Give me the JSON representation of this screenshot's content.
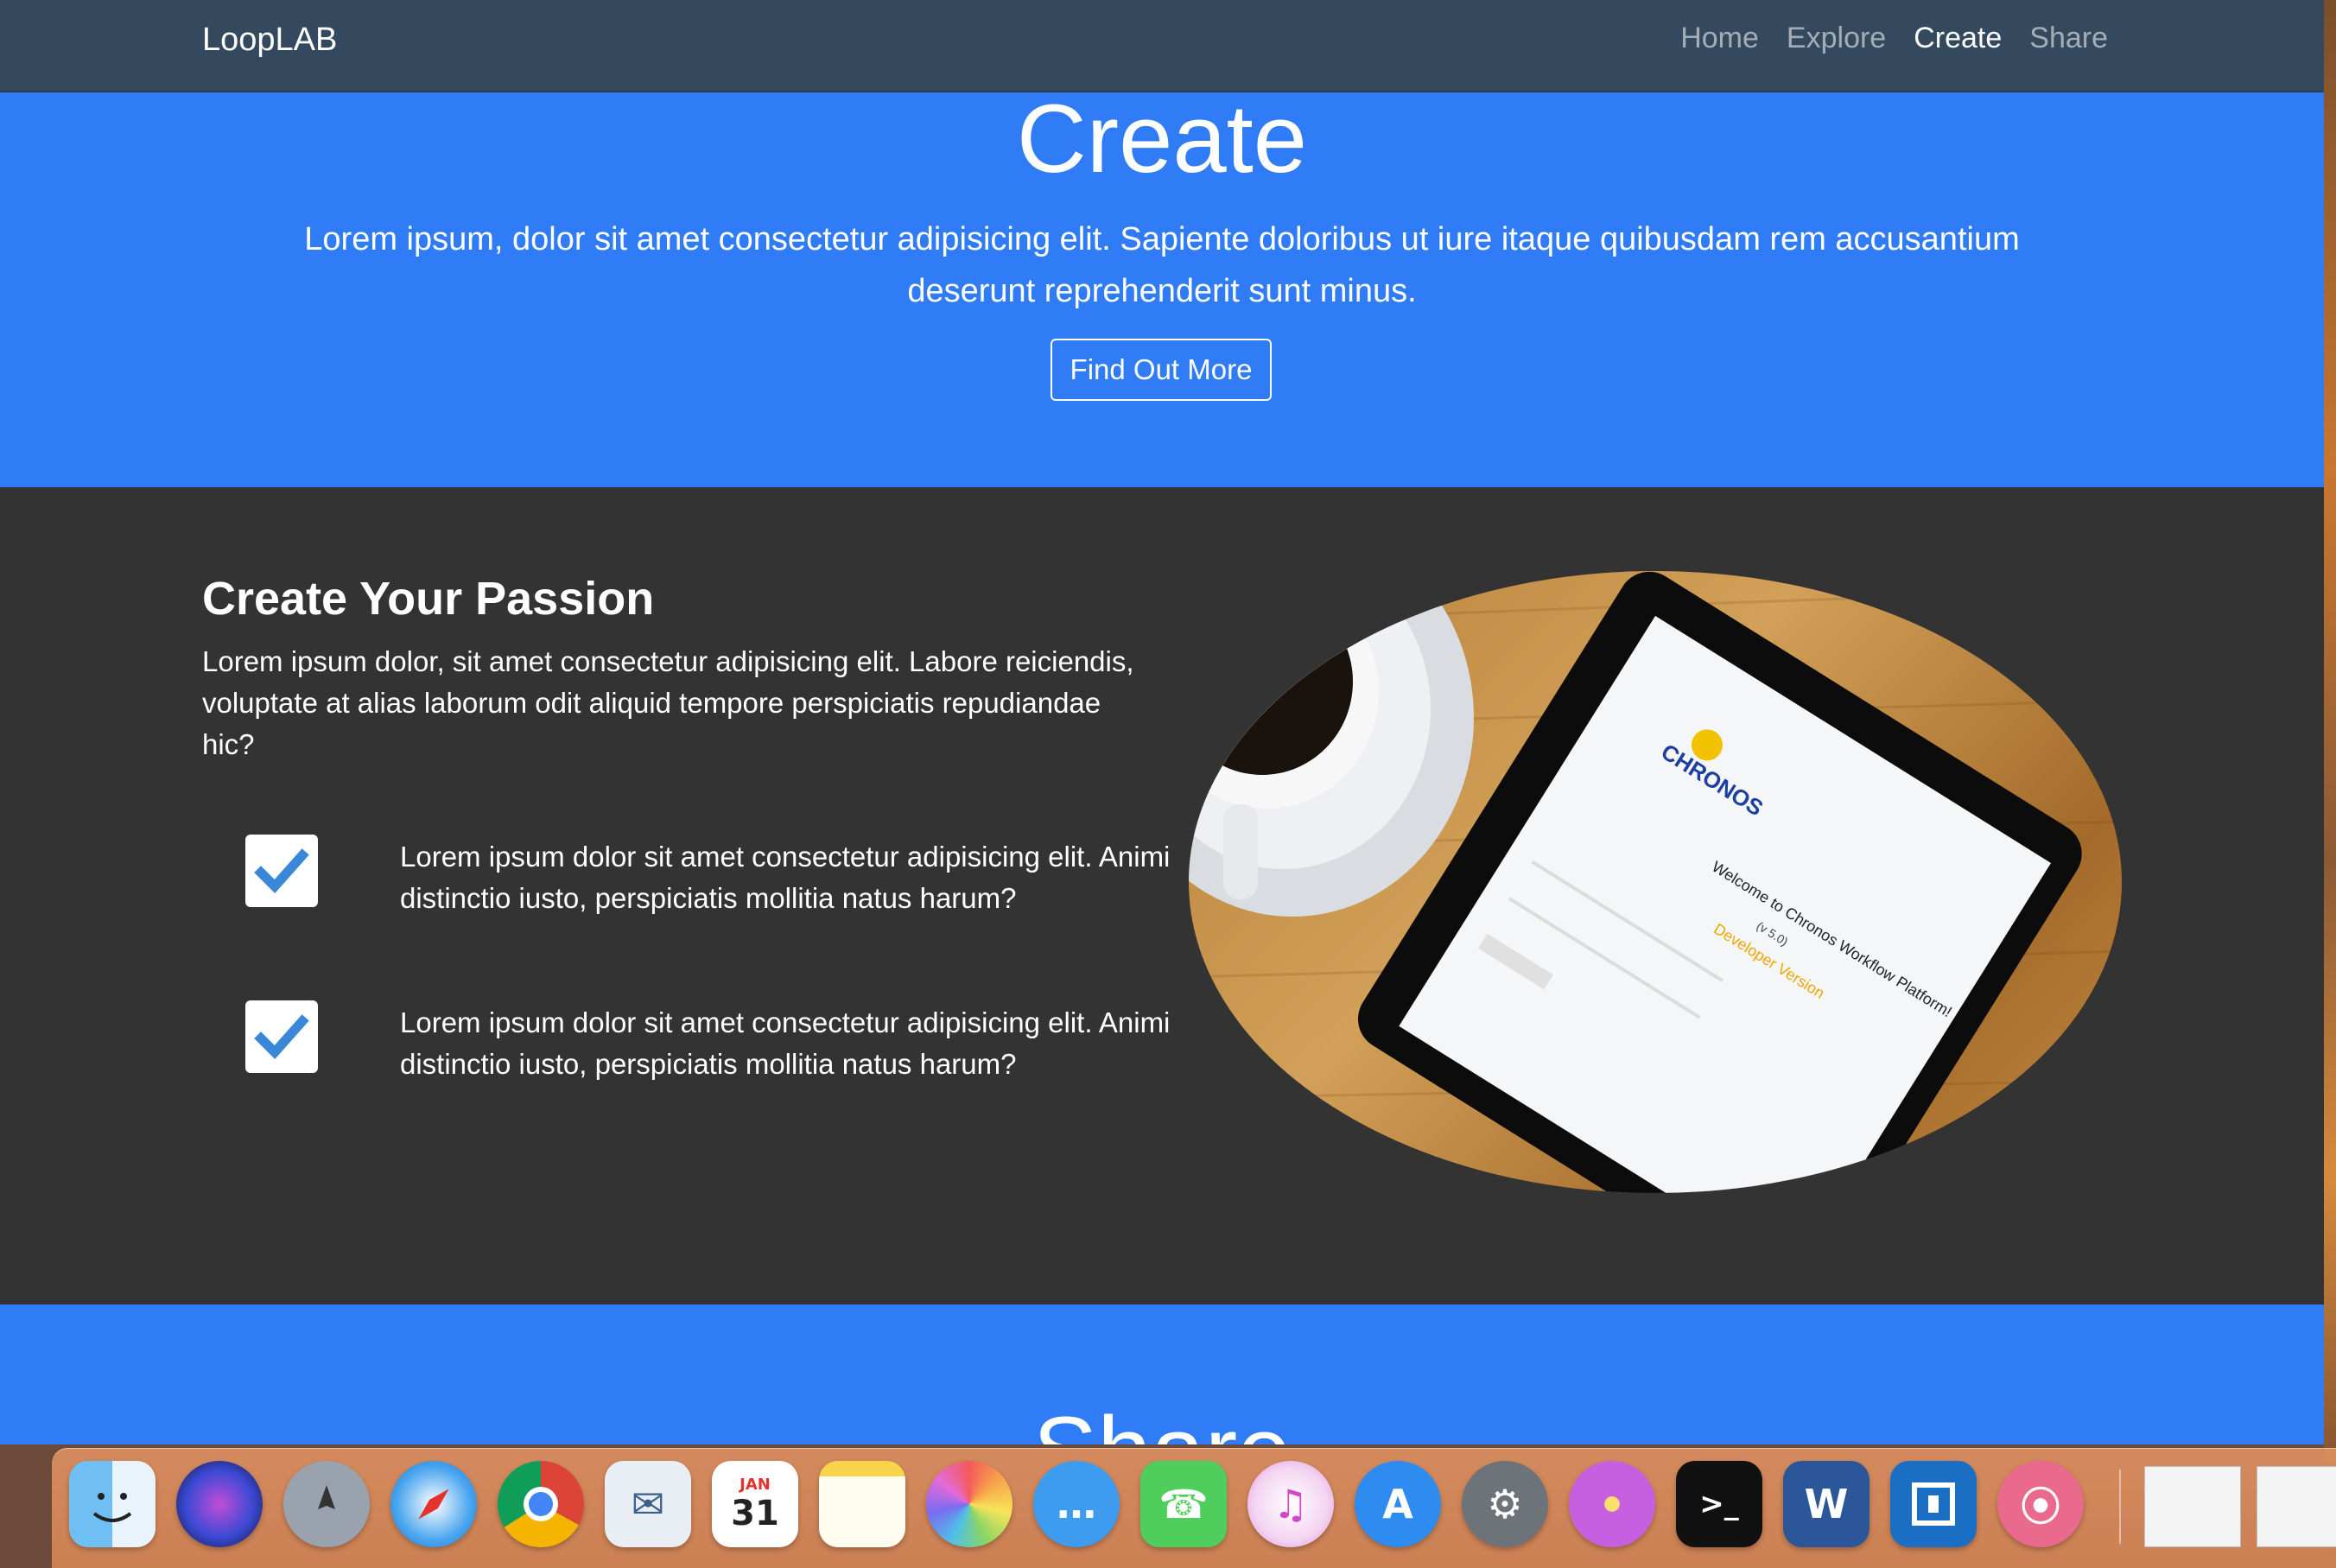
{
  "navbar": {
    "brand": "LoopLAB",
    "links": [
      {
        "label": "Home",
        "active": false
      },
      {
        "label": "Explore",
        "active": false
      },
      {
        "label": "Create",
        "active": true
      },
      {
        "label": "Share",
        "active": false
      }
    ]
  },
  "hero": {
    "title": "Create",
    "text": "Lorem ipsum, dolor sit amet consectetur adipisicing elit. Sapiente doloribus ut iure itaque quibusdam rem accusantium deserunt reprehenderit sunt minus.",
    "button_label": "Find Out More",
    "background": "#2f7cf6"
  },
  "passion": {
    "title": "Create Your Passion",
    "text": "Lorem ipsum dolor, sit amet consectetur adipisicing elit. Labore reiciendis, voluptate at alias laborum odit aliquid tempore perspiciatis repudiandae hic?",
    "features": [
      {
        "text": "Lorem ipsum dolor sit amet consectetur adipisicing elit. Animi distinctio iusto, perspiciatis mollitia natus harum?"
      },
      {
        "text": "Lorem ipsum dolor sit amet consectetur adipisicing elit. Animi distinctio iusto, perspiciatis mollitia natus harum?"
      }
    ],
    "image": {
      "app_title": "Welcome to Chronos Workflow Platform!",
      "version": "(v 5.0)",
      "edition": "Developer Version",
      "logo_text": "CHRONOS"
    },
    "background": "#333333",
    "check_color": "#3a87d8"
  },
  "share": {
    "title": "Share"
  },
  "dock": {
    "apps": [
      {
        "name": "finder-icon"
      },
      {
        "name": "siri-icon"
      },
      {
        "name": "launchpad-icon"
      },
      {
        "name": "safari-icon"
      },
      {
        "name": "chrome-icon"
      },
      {
        "name": "mail-icon"
      },
      {
        "name": "calendar-icon",
        "month": "JAN",
        "day": "31"
      },
      {
        "name": "notes-icon"
      },
      {
        "name": "photos-icon"
      },
      {
        "name": "messages-icon"
      },
      {
        "name": "facetime-icon"
      },
      {
        "name": "itunes-icon"
      },
      {
        "name": "app-store-icon"
      },
      {
        "name": "system-preferences-icon"
      },
      {
        "name": "flower-icon"
      },
      {
        "name": "terminal-icon",
        "glyph": ">_"
      },
      {
        "name": "word-icon",
        "glyph": "W"
      },
      {
        "name": "framer-icon"
      },
      {
        "name": "archive-utility-icon"
      }
    ]
  }
}
